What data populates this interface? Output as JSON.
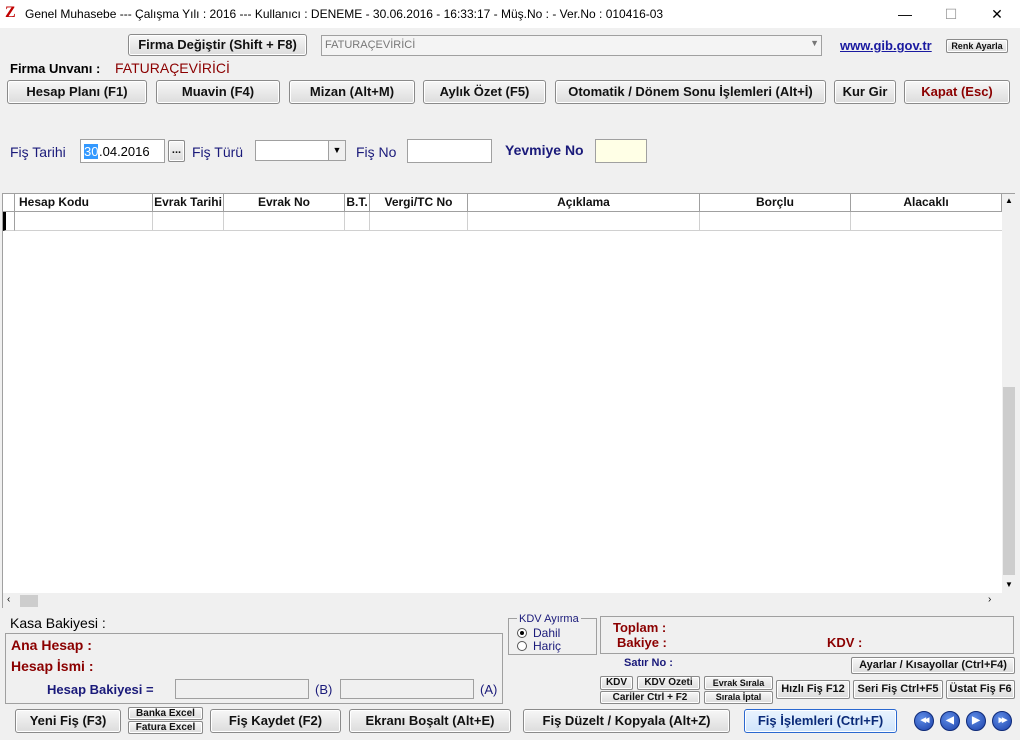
{
  "window": {
    "title": "Genel Muhasebe  ---  Çalışma Yılı : 2016  ---  Kullanıcı : DENEME - 30.06.2016 - 16:33:17 - Müş.No :  - Ver.No : 010416-03",
    "logo": "Z",
    "minimize": "—",
    "maximize": "☐",
    "close": "✕"
  },
  "top": {
    "firma_degistir": "Firma Değiştir (Shift + F8)",
    "firma_select": "FATURAÇEVİRİCİ",
    "gib_link": "www.gib.gov.tr",
    "renk_ayarla": "Renk Ayarla",
    "firma_unvani_label": "Firma Unvanı :",
    "firma_unvani_value": "FATURAÇEVİRİCİ"
  },
  "toolbar": {
    "hesap_plani": "Hesap Planı (F1)",
    "muavin": "Muavin (F4)",
    "mizan": "Mizan (Alt+M)",
    "aylik_ozet": "Aylık Özet (F5)",
    "otomatik": "Otomatik / Dönem Sonu İşlemleri (Alt+İ)",
    "kur_gir": "Kur Gir",
    "kapat": "Kapat (Esc)"
  },
  "form": {
    "fis_tarihi_label": "Fiş Tarihi",
    "fis_tarihi_day": "30",
    "fis_tarihi_rest": ".04.2016",
    "date_button": "...",
    "fis_turu_label": "Fiş Türü",
    "fis_turu_value": "",
    "fis_no_label": "Fiş No",
    "fis_no_value": "",
    "yevmiye_no_label": "Yevmiye No",
    "yevmiye_no_value": ""
  },
  "grid": {
    "columns": [
      "Hesap Kodu",
      "Evrak Tarihi",
      "Evrak No",
      "B.T.",
      "Vergi/TC No",
      "Açıklama",
      "Borçlu",
      "Alacaklı"
    ]
  },
  "bottom": {
    "kasa_bakiyesi": "Kasa Bakiyesi :",
    "ana_hesap": "Ana Hesap :",
    "hesap_ismi": "Hesap İsmi :",
    "hesap_bakiyesi": "Hesap Bakiyesi =",
    "b_label": "(B)",
    "a_label": "(A)",
    "kdv_ayirma": "KDV Ayırma",
    "dahil": "Dahil",
    "haric": "Hariç",
    "toplam": "Toplam :",
    "bakiye": "Bakiye :",
    "kdv": "KDV :",
    "satir_no": "Satır No :",
    "ayarlar": "Ayarlar / Kısayollar (Ctrl+F4)",
    "kdv_btn": "KDV",
    "kdv_ozeti": "KDV Özeti",
    "evrak_sirala": "Evrak Sırala",
    "cariler": "Cariler Ctrl + F2",
    "sirala_iptal": "Sırala İptal",
    "hizli_fis": "Hızlı Fiş F12",
    "seri_fis": "Seri Fiş Ctrl+F5",
    "ustat_fis": "Üstat Fiş F6"
  },
  "footer": {
    "yeni_fis": "Yeni Fiş (F3)",
    "banka_excel": "Banka Excel",
    "fatura_excel": "Fatura Excel",
    "fis_kaydet": "Fiş Kaydet (F2)",
    "ekrani_bosalt": "Ekranı Boşalt (Alt+E)",
    "fis_duzelt": "Fiş Düzelt / Kopyala (Alt+Z)",
    "fis_islemleri": "Fiş İşlemleri (Ctrl+F)",
    "nav_first": "◀◀",
    "nav_prev": "◀",
    "nav_next": "▶",
    "nav_last": "▶▶"
  }
}
